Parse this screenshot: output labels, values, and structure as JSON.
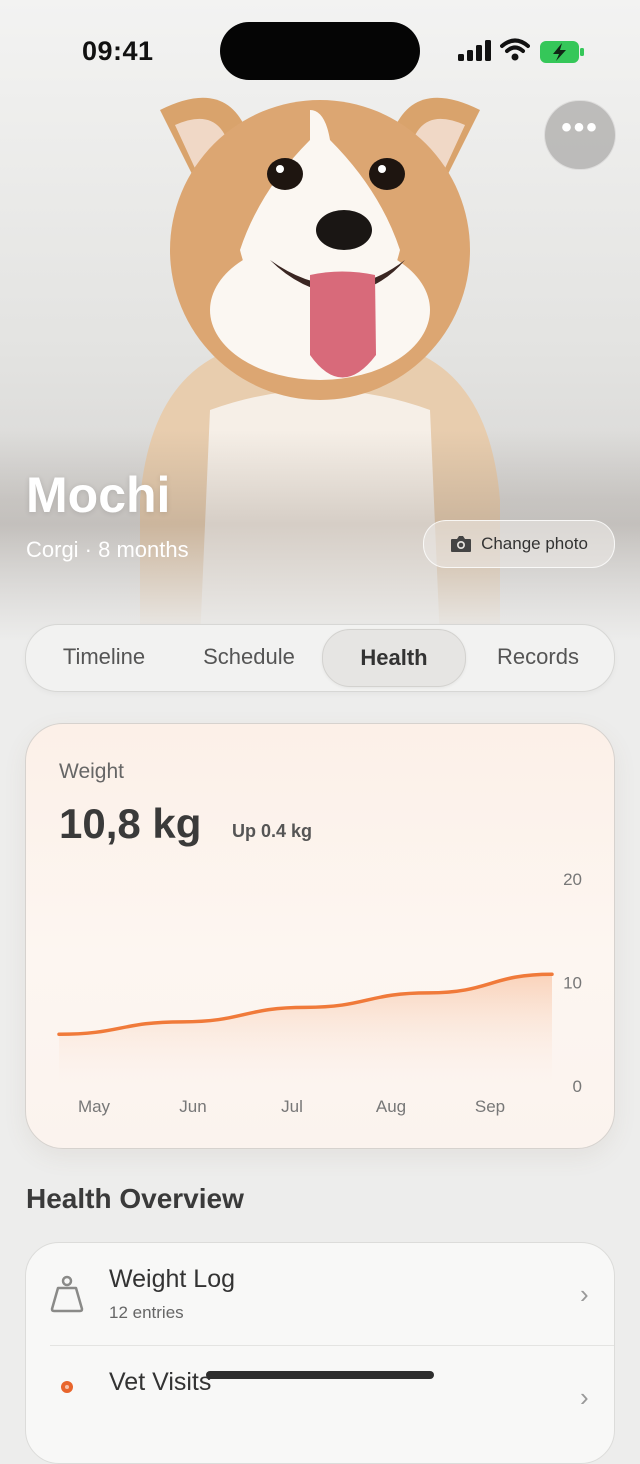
{
  "status_bar": {
    "time": "09:41"
  },
  "pet": {
    "name": "Mochi",
    "subtitle": "Corgi · 8 months"
  },
  "hero": {
    "more_label": "•••",
    "change_photo_label": "Change photo"
  },
  "tabs": [
    {
      "label": "Timeline",
      "active": false
    },
    {
      "label": "Schedule",
      "active": false
    },
    {
      "label": "Health",
      "active": true
    },
    {
      "label": "Records",
      "active": false
    }
  ],
  "weight_card": {
    "label": "Weight",
    "value": "10,8 kg",
    "change": "Up 0.4 kg"
  },
  "chart_data": {
    "type": "area",
    "categories": [
      "May",
      "Jun",
      "Jul",
      "Aug",
      "Sep"
    ],
    "series": [
      {
        "values": [
          5.0,
          6.2,
          7.6,
          9.0,
          10.8
        ]
      }
    ],
    "yticks": [
      0,
      10,
      20
    ],
    "ylim": [
      0,
      20
    ],
    "color": "#f07a3a",
    "grid": false
  },
  "overview": {
    "title": "Health Overview",
    "items": [
      {
        "icon": "scale-icon",
        "title": "Weight Log",
        "subtitle": "12 entries",
        "chevron": "›"
      },
      {
        "icon": "vet-dot-icon",
        "title": "Vet Visits",
        "subtitle": "",
        "chevron": "›"
      }
    ]
  },
  "colors": {
    "accent": "#f07a3a",
    "vet_dot": "#e8652c"
  }
}
